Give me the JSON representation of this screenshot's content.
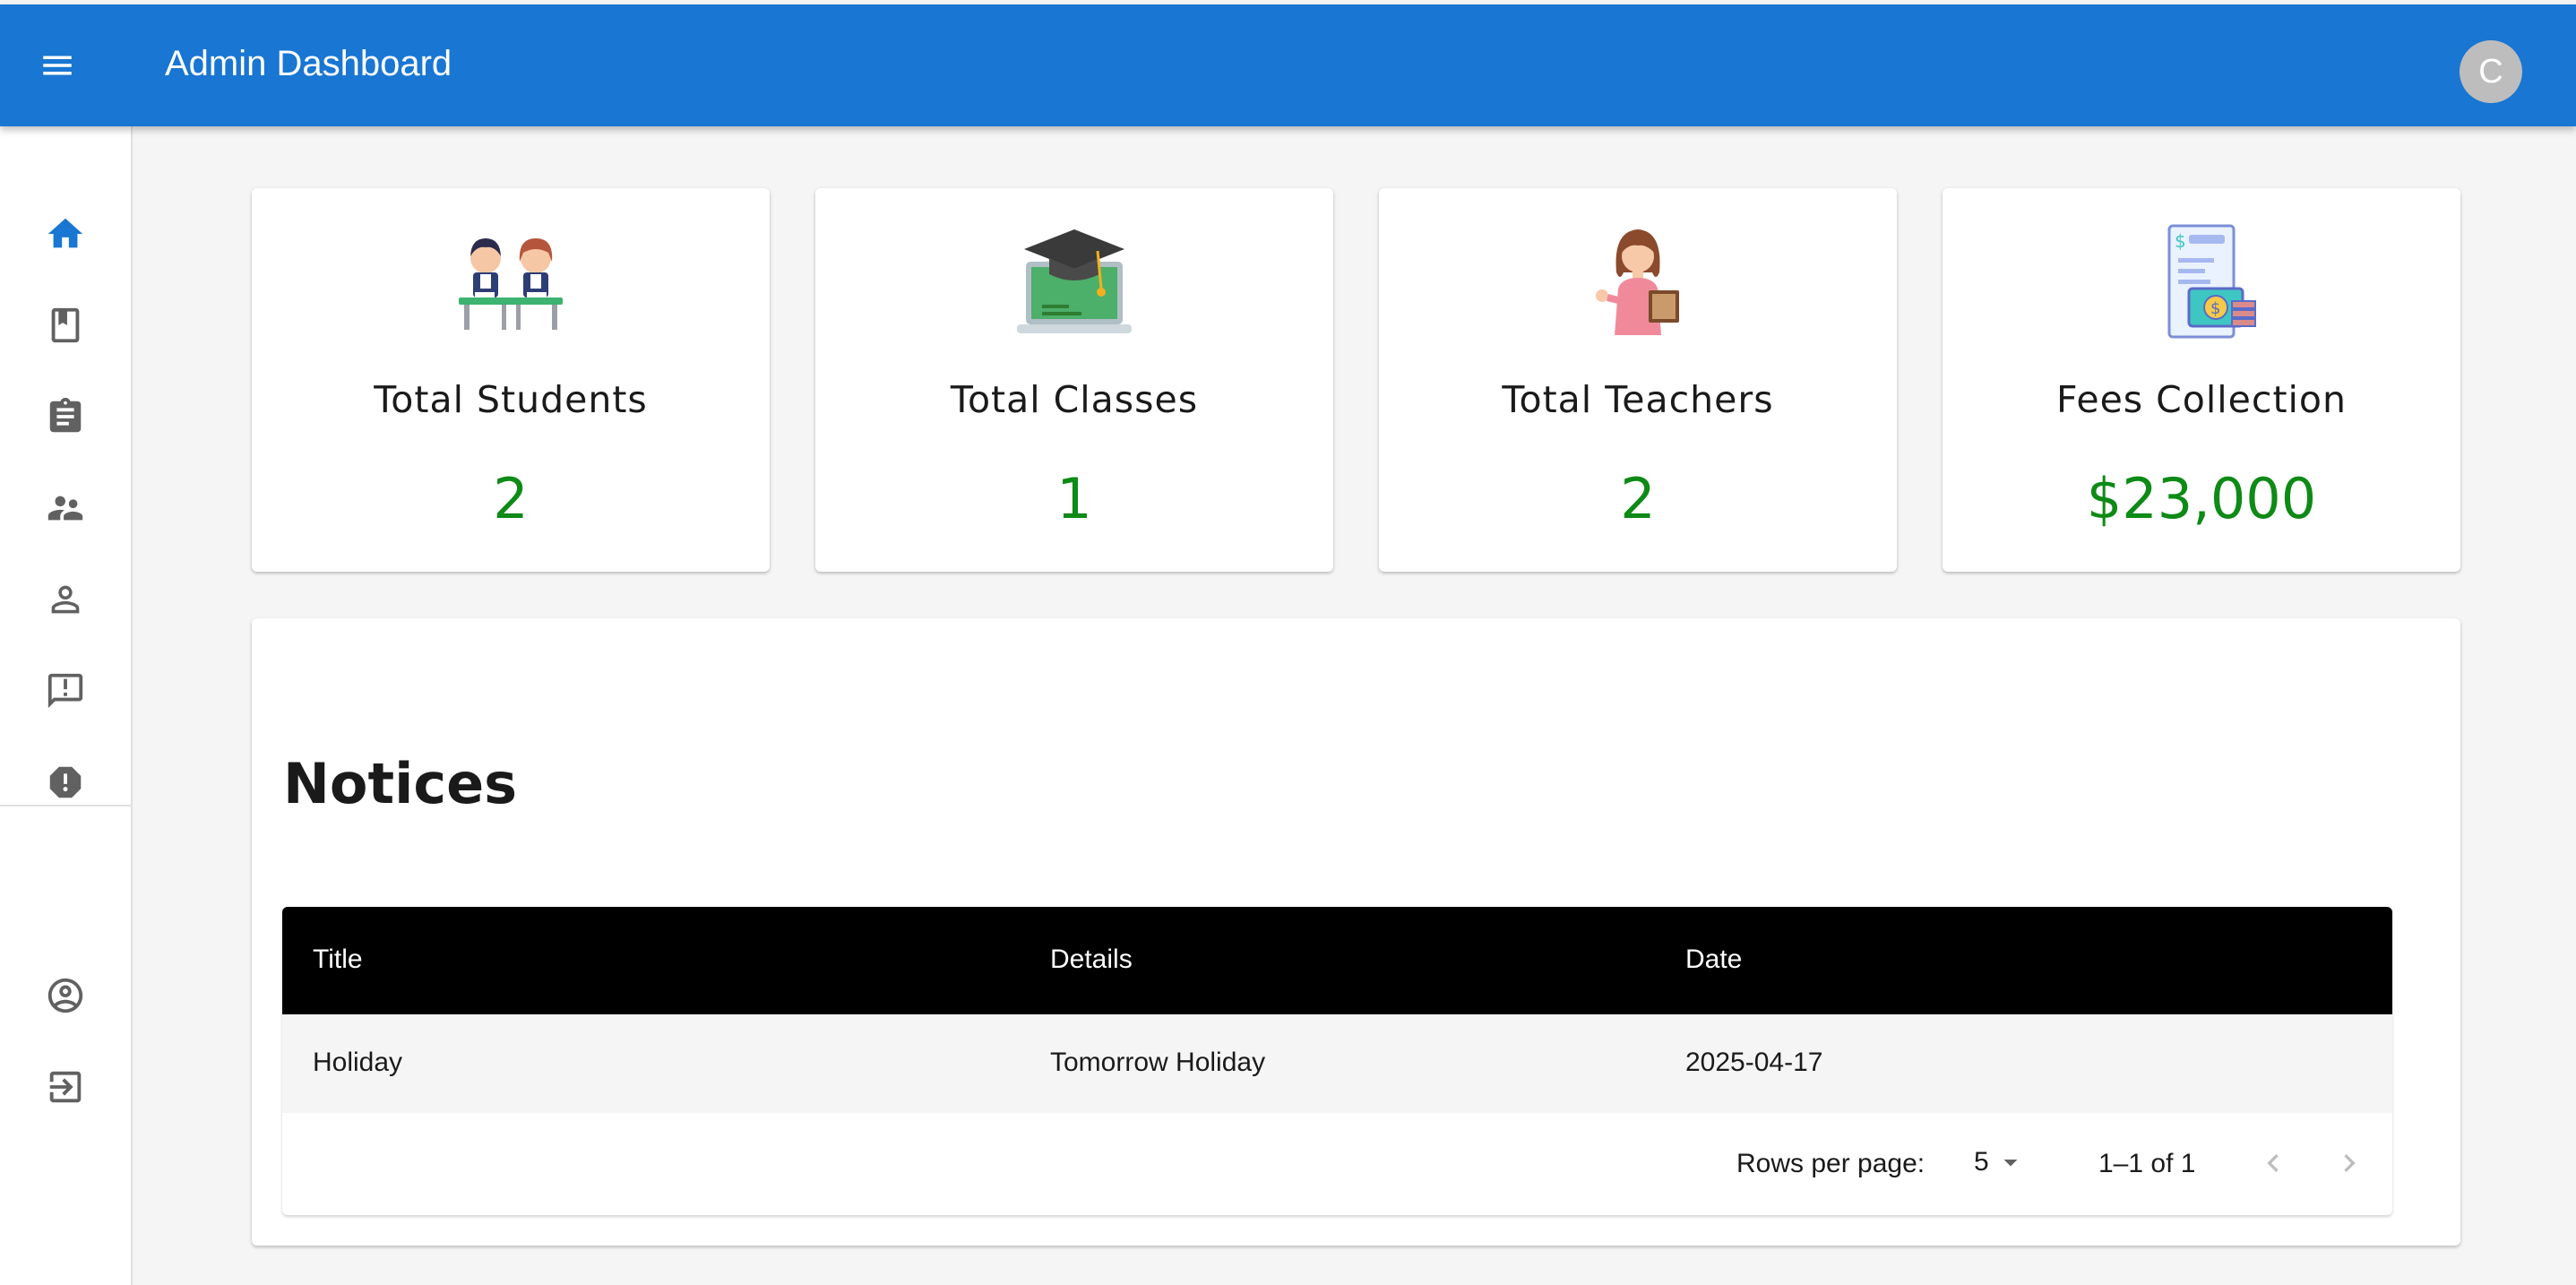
{
  "appbar": {
    "title": "Admin Dashboard",
    "avatar_letter": "C",
    "color": "#1976d2"
  },
  "sidebar": {
    "items": [
      {
        "name": "home",
        "icon": "home-icon",
        "active": true
      },
      {
        "name": "classes",
        "icon": "class-icon"
      },
      {
        "name": "subjects",
        "icon": "assignment-icon"
      },
      {
        "name": "teachers",
        "icon": "supervisor-account-icon"
      },
      {
        "name": "students",
        "icon": "person-outline-icon"
      },
      {
        "name": "notices",
        "icon": "announcement-icon"
      },
      {
        "name": "complains",
        "icon": "report-icon"
      },
      {
        "name": "profile",
        "icon": "account-circle-icon"
      },
      {
        "name": "logout",
        "icon": "exit-to-app-icon"
      }
    ]
  },
  "stats": [
    {
      "title": "Total Students",
      "value": "2",
      "icon": "students-illustration"
    },
    {
      "title": "Total Classes",
      "value": "1",
      "icon": "graduation-laptop-illustration"
    },
    {
      "title": "Total Teachers",
      "value": "2",
      "icon": "teacher-illustration"
    },
    {
      "title": "Fees Collection",
      "value": "$23,000",
      "icon": "fees-invoice-illustration"
    }
  ],
  "notices": {
    "heading": "Notices",
    "columns": [
      "Title",
      "Details",
      "Date"
    ],
    "rows": [
      {
        "title": "Holiday",
        "details": "Tomorrow Holiday",
        "date": "2025-04-17"
      }
    ],
    "pagination": {
      "rows_per_page_label": "Rows per page:",
      "rows_per_page": "5",
      "range": "1–1 of 1"
    }
  },
  "colors": {
    "value_green": "#0e8a16",
    "active_icon": "#1976d2",
    "icon_grey": "#616161"
  }
}
